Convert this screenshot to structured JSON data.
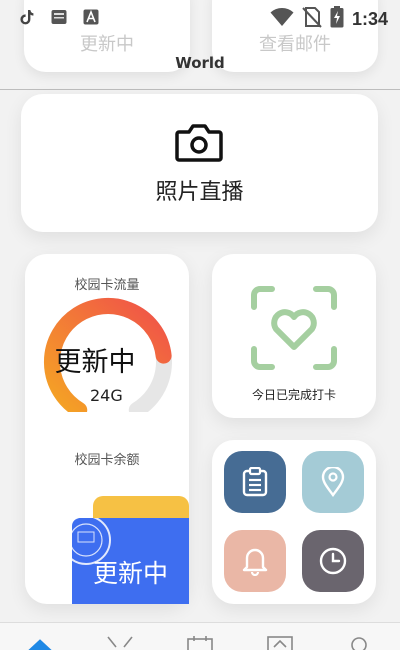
{
  "status_bar": {
    "time": "1:34",
    "left_icons": [
      "tiktok-icon",
      "app-notification-icon",
      "font-app-icon"
    ],
    "right_icons": [
      "wifi-icon",
      "no-sim-icon",
      "battery-charging-icon"
    ]
  },
  "top_cards": {
    "left_label": "更新中",
    "right_label": "查看邮件"
  },
  "header": {
    "title": "World"
  },
  "photo_card": {
    "label": "照片直播",
    "icon": "camera-icon"
  },
  "campus_card": {
    "traffic_title": "校园卡流量",
    "traffic_value": "更新中",
    "traffic_sub": "24G",
    "balance_title": "校园卡余额",
    "balance_value": "更新中",
    "gauge_fill_fraction": 0.78,
    "gauge_colors": [
      "#f5a623",
      "#f0504a"
    ],
    "card_colors": {
      "front": "#3e6ef0",
      "back": "#f6c144"
    }
  },
  "checkin_card": {
    "label": "今日已完成打卡",
    "icon": "heart-scan-icon",
    "color": "#a5cfa0"
  },
  "apps_card": {
    "apps": [
      {
        "icon": "clipboard-icon",
        "color": "#466c94"
      },
      {
        "icon": "location-pin-icon",
        "color": "#a4cbd6"
      },
      {
        "icon": "bell-icon",
        "color": "#eab7a6"
      },
      {
        "icon": "clock-icon",
        "color": "#6a656e"
      }
    ]
  },
  "bottom_nav": {
    "items": [
      "home-icon",
      "discover-icon",
      "calendar-icon",
      "gallery-icon",
      "search-icon"
    ],
    "active_color": "#1e88e5"
  }
}
